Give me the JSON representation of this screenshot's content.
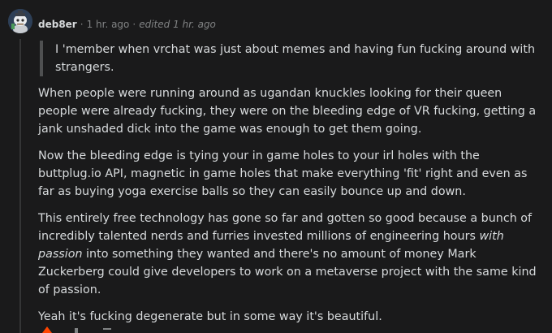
{
  "comment": {
    "username": "deb8er",
    "separator": "·",
    "time": "1 hr. ago",
    "edited": "edited 1 hr. ago",
    "quote": "I 'member when vrchat was just about memes and having fun fucking around with strangers.",
    "paragraph_1": "When people were running around as ugandan knuckles looking for their queen people were already fucking, they were on the bleeding edge of VR fucking, getting a jank unshaded dick into the game was enough to get them going.",
    "paragraph_2": "Now the bleeding edge is tying your in game holes to your irl holes with the buttplug.io API, magnetic in game holes that make everything 'fit' right and even as far as buying yoga exercise balls so they can easily bounce up and down.",
    "paragraph_3_before": "This entirely free technology has gone so far and gotten so good because a bunch of incredibly talented nerds and furries invested millions of engineering hours ",
    "paragraph_3_emphasis": "with passion",
    "paragraph_3_after": " into something they wanted and there's no amount of money Mark Zuckerberg could give developers to work on a metaverse project with the same kind of passion.",
    "paragraph_4": "Yeah it's fucking degenerate but in some way it's beautiful."
  },
  "icons": {
    "avatar": "snoo-avatar",
    "upvote": "upvote-arrow-icon"
  },
  "colors": {
    "background": "#1a1a1b",
    "text": "#d7dadc",
    "muted": "#818384",
    "quote_bar": "#4f5051",
    "upvote": "#ff4500"
  }
}
